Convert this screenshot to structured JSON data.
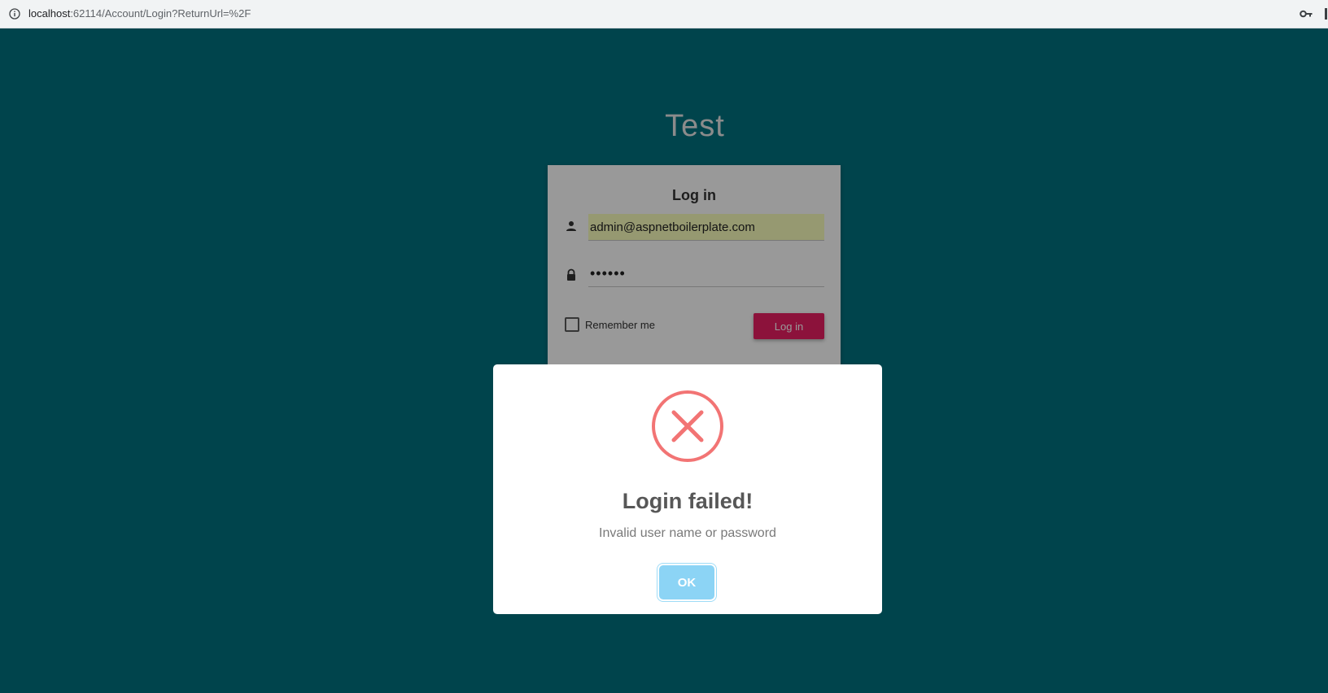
{
  "browser": {
    "url_host": "localhost",
    "url_rest": ":62114/Account/Login?ReturnUrl=%2F"
  },
  "page": {
    "app_title": "Test",
    "login_card": {
      "title": "Log in",
      "username_value": "admin@aspnetboilerplate.com",
      "password_value": "••••••",
      "remember_me_label": "Remember me",
      "remember_me_checked": false,
      "login_button_label": "Log in"
    }
  },
  "dialog": {
    "title": "Login failed!",
    "message": "Invalid user name or password",
    "ok_label": "OK"
  },
  "colors": {
    "background": "#00727f",
    "login_button": "#e91e63",
    "error_icon": "#f27474",
    "ok_button": "#8cd4f5",
    "autofill": "#faffbd"
  },
  "icons": {
    "address_info": "info-icon",
    "address_key": "key-icon",
    "username": "person-icon",
    "password": "lock-icon",
    "dialog": "error-x-icon"
  }
}
